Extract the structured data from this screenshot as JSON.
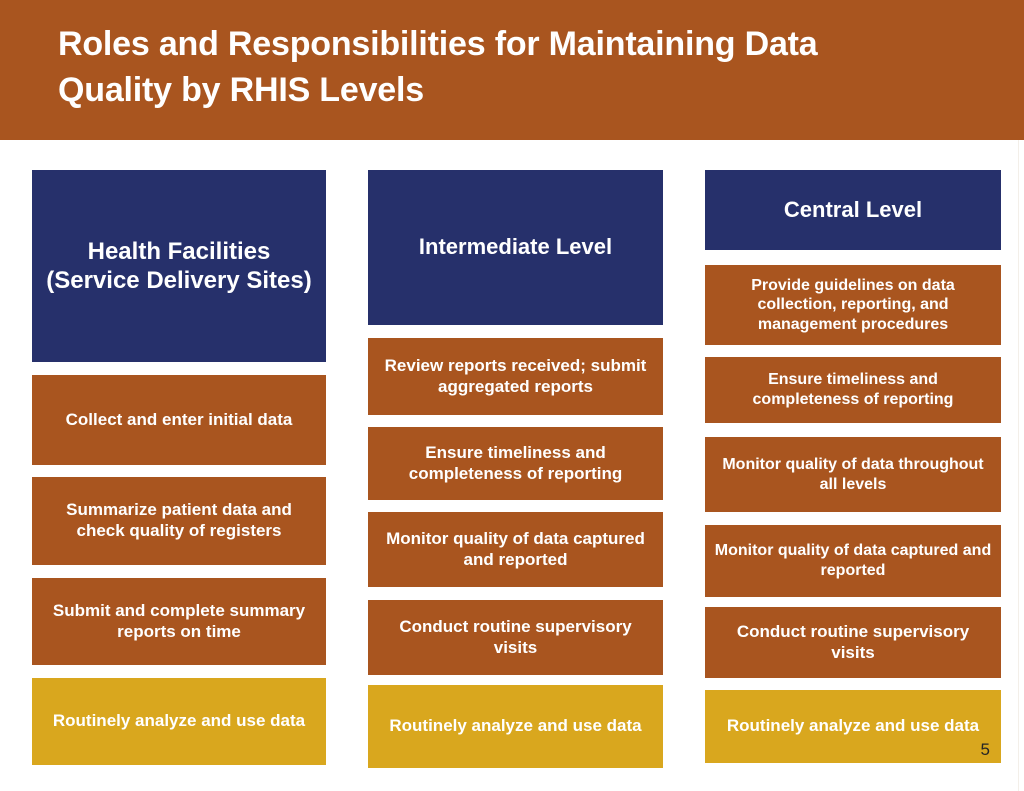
{
  "slide": {
    "title": "Roles and Responsibilities for Maintaining Data Quality by RHIS Levels",
    "page_number": "5",
    "colors": {
      "band_orange": "#a9551f",
      "header_navy": "#26306b",
      "task_orange": "#a9551f",
      "accent_yellow": "#d9a71e",
      "text_white": "#ffffff",
      "background": "#ffffff"
    }
  },
  "columns": [
    {
      "id": "health-facilities",
      "header": "Health Facilities (Service Delivery Sites)",
      "items": [
        {
          "label": "Collect and enter initial data",
          "style": "task"
        },
        {
          "label": "Summarize patient data and check quality of registers",
          "style": "task"
        },
        {
          "label": "Submit and complete summary reports on time",
          "style": "task"
        },
        {
          "label": "Routinely analyze and use data",
          "style": "accent"
        }
      ]
    },
    {
      "id": "intermediate-level",
      "header": "Intermediate Level",
      "items": [
        {
          "label": "Review reports received; submit aggregated reports",
          "style": "task"
        },
        {
          "label": "Ensure timeliness and completeness of reporting",
          "style": "task"
        },
        {
          "label": "Monitor quality of data captured and reported",
          "style": "task"
        },
        {
          "label": "Conduct routine supervisory visits",
          "style": "task"
        },
        {
          "label": "Routinely analyze and use data",
          "style": "accent"
        }
      ]
    },
    {
      "id": "central-level",
      "header": "Central Level",
      "items": [
        {
          "label": "Provide guidelines on data collection, reporting, and management procedures",
          "style": "task"
        },
        {
          "label": "Ensure timeliness and completeness of reporting",
          "style": "task"
        },
        {
          "label": "Monitor quality of data throughout all levels",
          "style": "task"
        },
        {
          "label": "Monitor quality of data captured and reported",
          "style": "task"
        },
        {
          "label": "Conduct routine supervisory visits",
          "style": "task"
        },
        {
          "label": "Routinely analyze and use data",
          "style": "accent"
        }
      ]
    }
  ]
}
